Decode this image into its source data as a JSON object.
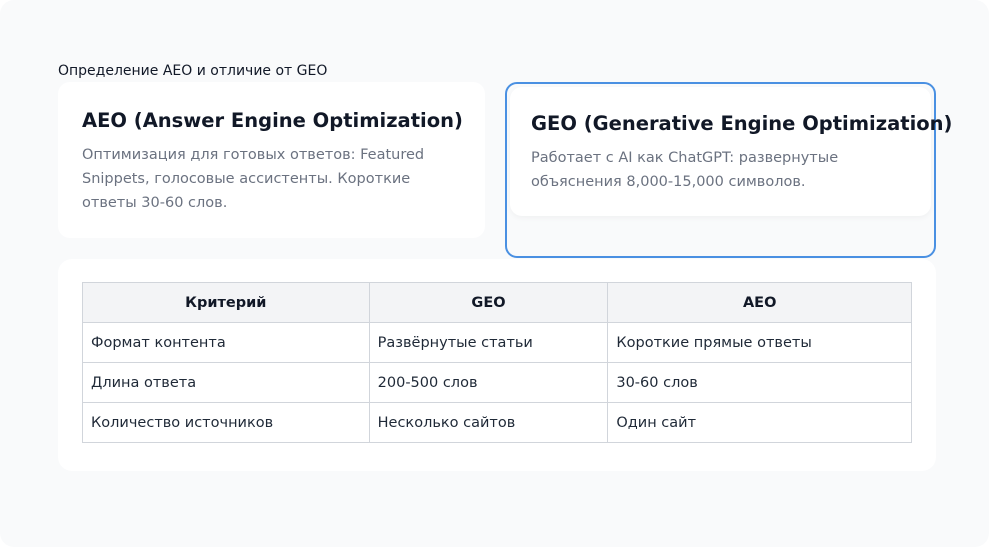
{
  "section_title": "Определение AEO и отличие от GEO",
  "cards": {
    "aeo": {
      "title": "AEO (Answer Engine Optimization)",
      "text": "Оптимизация для готовых ответов: Featured Snippets, голосовые ассистенты. Короткие ответы 30-60 слов."
    },
    "geo": {
      "title": "GEO (Generative Engine Optimization)",
      "text": "Работает с AI как ChatGPT: развернутые объяснения 8,000-15,000 символов."
    }
  },
  "accent_color": "#4a90e2",
  "table": {
    "headers": [
      "Критерий",
      "GEO",
      "AEO"
    ],
    "rows": [
      [
        "Формат контента",
        "Развёрнутые статьи",
        "Короткие прямые ответы"
      ],
      [
        "Длина ответа",
        "200-500 слов",
        "30-60 слов"
      ],
      [
        "Количество источников",
        "Несколько сайтов",
        "Один сайт"
      ]
    ]
  }
}
